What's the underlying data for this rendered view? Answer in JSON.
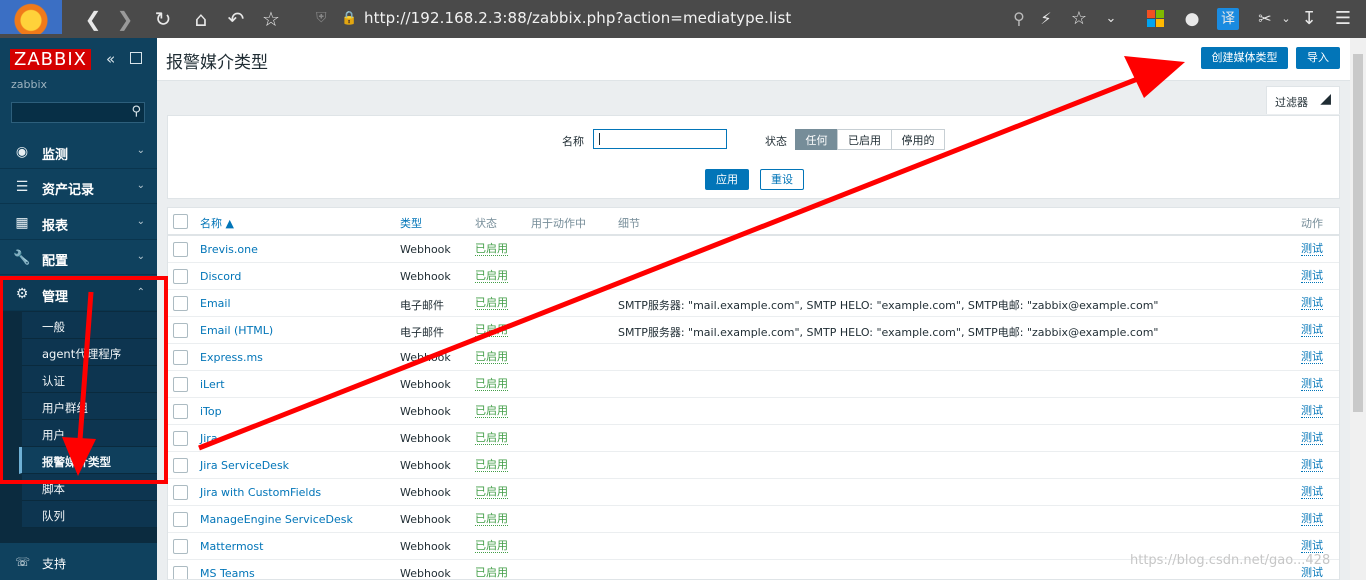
{
  "browser": {
    "url": "http://192.168.2.3:88/zabbix.php?action=mediatype.list",
    "translate_label": "译"
  },
  "sidebar": {
    "brand": "ZABBIX",
    "server_name": "zabbix",
    "menu": [
      {
        "label": "监测",
        "icon": "eye-icon"
      },
      {
        "label": "资产记录",
        "icon": "list-icon"
      },
      {
        "label": "报表",
        "icon": "bar-chart-icon"
      },
      {
        "label": "配置",
        "icon": "wrench-icon"
      },
      {
        "label": "管理",
        "icon": "gear-icon"
      }
    ],
    "admin_submenu": [
      "一般",
      "agent代理程序",
      "认证",
      "用户群组",
      "用户",
      "报警媒介类型",
      "脚本",
      "队列"
    ],
    "support": "支持"
  },
  "header": {
    "title": "报警媒介类型",
    "create_button": "创建媒体类型",
    "import_button": "导入"
  },
  "filter": {
    "tab_label": "过滤器",
    "name_label": "名称",
    "name_value": "",
    "status_label": "状态",
    "status_options": [
      "任何",
      "已启用",
      "停用的"
    ],
    "status_selected": "任何",
    "apply": "应用",
    "reset": "重设"
  },
  "table": {
    "headers": [
      "名称 ▲",
      "类型",
      "状态",
      "用于动作中",
      "细节",
      "动作"
    ],
    "rows": [
      {
        "name": "Brevis.one",
        "type": "Webhook",
        "status": "已启用",
        "details": "",
        "action": "测试"
      },
      {
        "name": "Discord",
        "type": "Webhook",
        "status": "已启用",
        "details": "",
        "action": "测试"
      },
      {
        "name": "Email",
        "type": "电子邮件",
        "status": "已启用",
        "details": "SMTP服务器: \"mail.example.com\", SMTP HELO: \"example.com\", SMTP电邮: \"zabbix@example.com\"",
        "action": "测试"
      },
      {
        "name": "Email (HTML)",
        "type": "电子邮件",
        "status": "已启用",
        "details": "SMTP服务器: \"mail.example.com\", SMTP HELO: \"example.com\", SMTP电邮: \"zabbix@example.com\"",
        "action": "测试"
      },
      {
        "name": "Express.ms",
        "type": "Webhook",
        "status": "已启用",
        "details": "",
        "action": "测试"
      },
      {
        "name": "iLert",
        "type": "Webhook",
        "status": "已启用",
        "details": "",
        "action": "测试"
      },
      {
        "name": "iTop",
        "type": "Webhook",
        "status": "已启用",
        "details": "",
        "action": "测试"
      },
      {
        "name": "Jira",
        "type": "Webhook",
        "status": "已启用",
        "details": "",
        "action": "测试"
      },
      {
        "name": "Jira ServiceDesk",
        "type": "Webhook",
        "status": "已启用",
        "details": "",
        "action": "测试"
      },
      {
        "name": "Jira with CustomFields",
        "type": "Webhook",
        "status": "已启用",
        "details": "",
        "action": "测试"
      },
      {
        "name": "ManageEngine ServiceDesk",
        "type": "Webhook",
        "status": "已启用",
        "details": "",
        "action": "测试"
      },
      {
        "name": "Mattermost",
        "type": "Webhook",
        "status": "已启用",
        "details": "",
        "action": "测试"
      },
      {
        "name": "MS Teams",
        "type": "Webhook",
        "status": "已启用",
        "details": "",
        "action": "测试"
      }
    ]
  },
  "watermark": "https://blog.csdn.net/gao...428",
  "colors": {
    "sidebar": "#0f415e",
    "accent": "#0275b8",
    "enabled": "#429e47",
    "annotation": "#ff0000",
    "brand": "#d40000"
  }
}
